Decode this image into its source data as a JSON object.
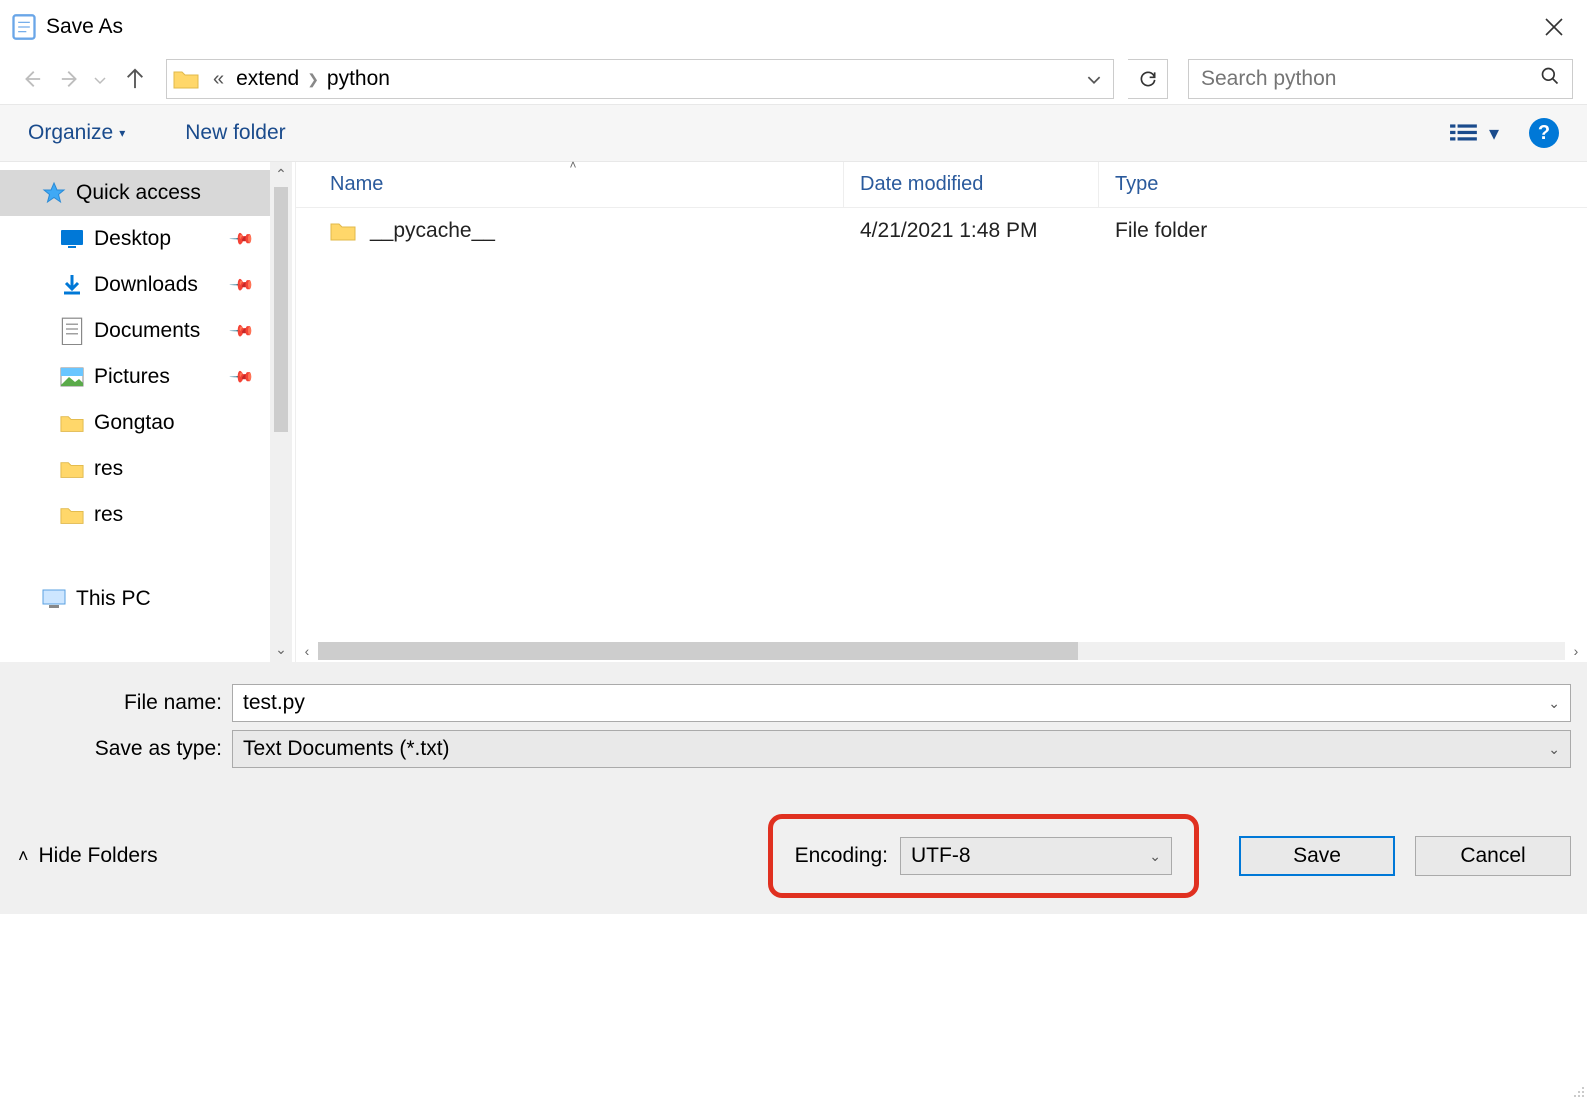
{
  "window": {
    "title": "Save As"
  },
  "breadcrumb": {
    "parent": "extend",
    "current": "python"
  },
  "search": {
    "placeholder": "Search python"
  },
  "toolbar": {
    "organize": "Organize",
    "new_folder": "New folder"
  },
  "sidebar": {
    "items": [
      {
        "label": "Quick access",
        "icon": "star",
        "pinned": false,
        "selected": true
      },
      {
        "label": "Desktop",
        "icon": "desktop",
        "pinned": true
      },
      {
        "label": "Downloads",
        "icon": "download",
        "pinned": true
      },
      {
        "label": "Documents",
        "icon": "document",
        "pinned": true
      },
      {
        "label": "Pictures",
        "icon": "pictures",
        "pinned": true
      },
      {
        "label": "Gongtao",
        "icon": "folder",
        "pinned": false
      },
      {
        "label": "res",
        "icon": "folder",
        "pinned": false
      },
      {
        "label": "res",
        "icon": "folder",
        "pinned": false
      }
    ],
    "this_pc": "This PC"
  },
  "columns": {
    "name": "Name",
    "date": "Date modified",
    "type": "Type"
  },
  "rows": [
    {
      "name": "__pycache__",
      "date": "4/21/2021 1:48 PM",
      "type": "File folder"
    }
  ],
  "form": {
    "filename_label": "File name:",
    "filename_value": "test.py",
    "saveastype_label": "Save as type:",
    "saveastype_value": "Text Documents (*.txt)",
    "encoding_label": "Encoding:",
    "encoding_value": "UTF-8",
    "hide_folders": "Hide Folders",
    "save": "Save",
    "cancel": "Cancel"
  }
}
